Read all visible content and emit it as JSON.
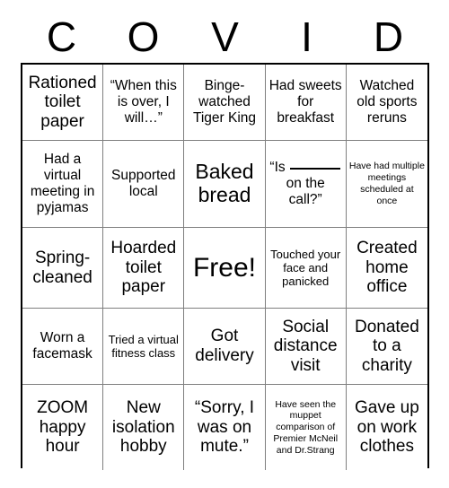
{
  "card": {
    "title_letters": [
      "C",
      "O",
      "V",
      "I",
      "D"
    ],
    "rows": [
      [
        {
          "text": "Rationed toilet paper",
          "size": "fs-lg"
        },
        {
          "text": "“When this is over, I will…”",
          "size": "fs-md"
        },
        {
          "text": "Binge-watched Tiger King",
          "size": "fs-md"
        },
        {
          "text": "Had sweets for breakfast",
          "size": "fs-md"
        },
        {
          "text": "Watched old sports reruns",
          "size": "fs-md"
        }
      ],
      [
        {
          "text": "Had a virtual meeting in pyjamas",
          "size": "fs-md"
        },
        {
          "text": "Supported local",
          "size": "fs-md"
        },
        {
          "text": "Baked bread",
          "size": "fs-xl"
        },
        {
          "text": "“Is ____ on the call?”",
          "size": "fs-md",
          "blank": true,
          "before": "“Is",
          "after": "on the call?”"
        },
        {
          "text": "Have had multiple meetings scheduled at once",
          "size": "fs-xs"
        }
      ],
      [
        {
          "text": "Spring-cleaned",
          "size": "fs-lg"
        },
        {
          "text": "Hoarded toilet paper",
          "size": "fs-lg"
        },
        {
          "text": "Free!",
          "size": "fs-xxl"
        },
        {
          "text": "Touched your face and panicked",
          "size": "fs-sm"
        },
        {
          "text": "Created home office",
          "size": "fs-lg"
        }
      ],
      [
        {
          "text": "Worn a facemask",
          "size": "fs-md"
        },
        {
          "text": "Tried a virtual fitness class",
          "size": "fs-sm"
        },
        {
          "text": "Got delivery",
          "size": "fs-lg"
        },
        {
          "text": "Social distance visit",
          "size": "fs-lg"
        },
        {
          "text": "Donated to a charity",
          "size": "fs-lg"
        }
      ],
      [
        {
          "text": "ZOOM happy hour",
          "size": "fs-lg"
        },
        {
          "text": "New isolation hobby",
          "size": "fs-lg"
        },
        {
          "text": "“Sorry, I was on mute.”",
          "size": "fs-lg"
        },
        {
          "text": "Have seen the muppet comparison of Premier McNeil and Dr.Strang",
          "size": "fs-xs"
        },
        {
          "text": "Gave up on work clothes",
          "size": "fs-lg"
        }
      ]
    ]
  }
}
